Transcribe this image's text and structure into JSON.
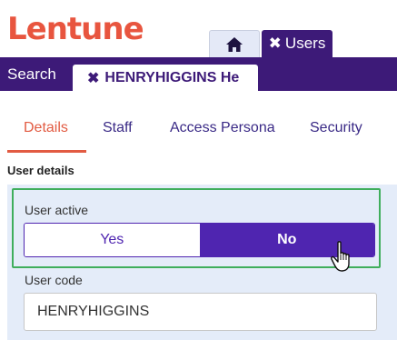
{
  "colors": {
    "brand": "#e8553f",
    "primary": "#3d1a78",
    "accent": "#4f25b0",
    "active_tab": "#e25b42",
    "highlight": "#3fae5c",
    "text_purple": "#3a2a86"
  },
  "logo": {
    "text": "Lentune"
  },
  "top_tabs": {
    "home_icon": "home-icon",
    "users_label": "Users"
  },
  "nav": {
    "search_label": "Search",
    "user_tab_label": "HENRYHIGGINS He"
  },
  "sub_tabs": [
    {
      "label": "Details",
      "active": true
    },
    {
      "label": "Staff",
      "active": false
    },
    {
      "label": "Access Persona",
      "active": false
    },
    {
      "label": "Security",
      "active": false
    }
  ],
  "form": {
    "section_title": "User details",
    "user_active_label": "User active",
    "yes_label": "Yes",
    "no_label": "No",
    "selected": "No",
    "user_code_label": "User code",
    "user_code_value": "HENRYHIGGINS"
  }
}
